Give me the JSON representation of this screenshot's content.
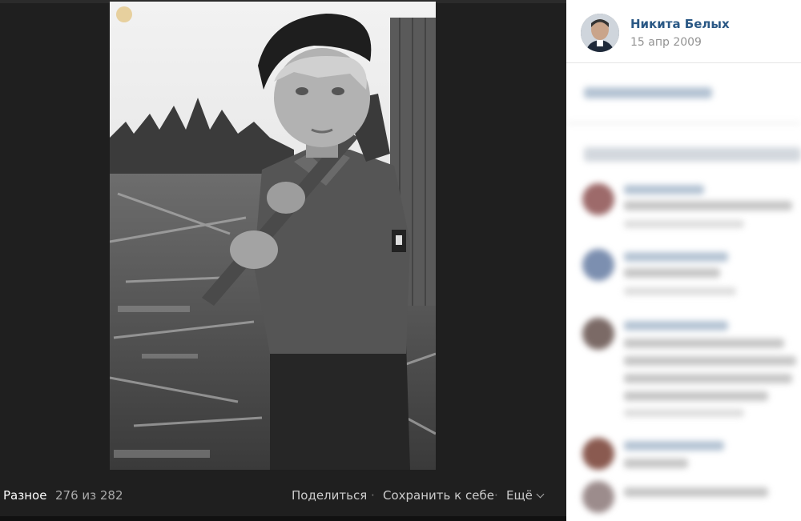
{
  "footer": {
    "album": "Разное",
    "counter": "276 из 282",
    "share_label": "Поделиться",
    "save_label": "Сохранить к себе",
    "more_label": "Ещё",
    "separator": "·"
  },
  "author": {
    "name": "Никита Белых",
    "date": "15 апр 2009"
  },
  "colors": {
    "link": "#2a5885",
    "viewer_bg": "#1f1f1f",
    "muted": "#939393"
  }
}
